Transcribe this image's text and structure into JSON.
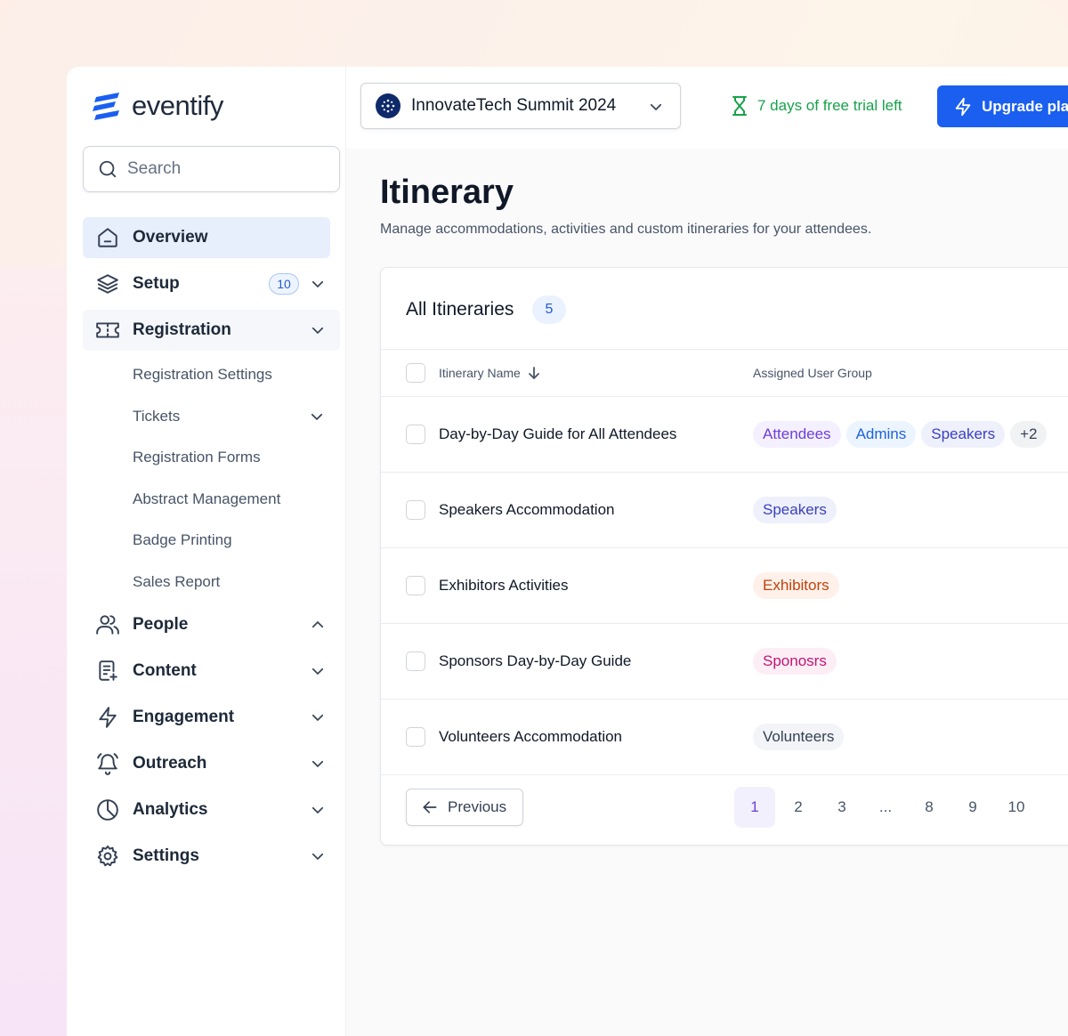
{
  "brand": {
    "name": "eventify"
  },
  "search": {
    "placeholder": "Search"
  },
  "sidebar": {
    "items": [
      {
        "label": "Overview",
        "icon": "home-icon"
      },
      {
        "label": "Setup",
        "icon": "layers-icon",
        "badge": "10"
      },
      {
        "label": "Registration",
        "icon": "ticket-icon"
      },
      {
        "label": "People",
        "icon": "users-icon"
      },
      {
        "label": "Content",
        "icon": "file-plus-icon"
      },
      {
        "label": "Engagement",
        "icon": "lightning-icon"
      },
      {
        "label": "Outreach",
        "icon": "bell-icon"
      },
      {
        "label": "Analytics",
        "icon": "pie-chart-icon"
      },
      {
        "label": "Settings",
        "icon": "gear-icon"
      }
    ],
    "registration_sub": [
      "Registration Settings",
      "Tickets",
      "Registration Forms",
      "Abstract Management",
      "Badge Printing",
      "Sales Report"
    ]
  },
  "topbar": {
    "event_name": "InnovateTech Summit 2024",
    "trial_text": "7 days of free trial left",
    "upgrade_label": "Upgrade plan"
  },
  "page": {
    "title": "Itinerary",
    "description": "Manage accommodations, activities and custom itineraries for your attendees."
  },
  "table": {
    "title": "All Itineraries",
    "count": "5",
    "columns": [
      "Itinerary Name",
      "Assigned User Group"
    ],
    "rows": [
      {
        "name": "Day-by-Day Guide for All Attendees",
        "tags": [
          "Attendees",
          "Admins",
          "Speakers",
          "+2"
        ]
      },
      {
        "name": "Speakers Accommodation",
        "tags": [
          "Speakers"
        ]
      },
      {
        "name": "Exhibitors Activities",
        "tags": [
          "Exhibitors"
        ]
      },
      {
        "name": "Sponsors Day-by-Day Guide",
        "tags": [
          "Sponosrs"
        ]
      },
      {
        "name": "Volunteers Accommodation",
        "tags": [
          "Volunteers"
        ]
      }
    ]
  },
  "pagination": {
    "previous_label": "Previous",
    "pages": [
      "1",
      "2",
      "3",
      "...",
      "8",
      "9",
      "10"
    ],
    "current": "1"
  },
  "colors": {
    "accent": "#1a5ff0",
    "trial": "#16a34a",
    "active_nav": "#e7eefc"
  }
}
